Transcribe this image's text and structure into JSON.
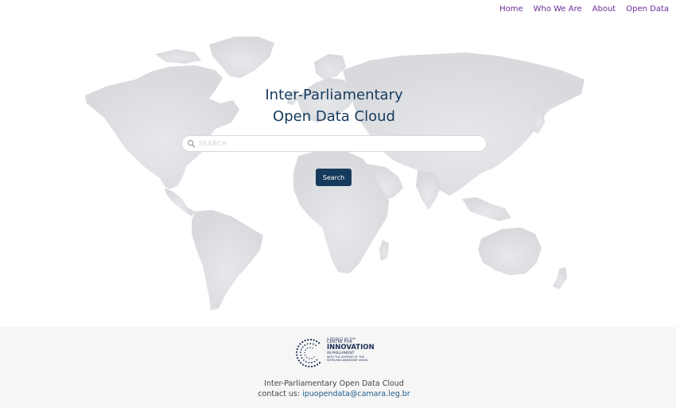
{
  "nav": {
    "items": [
      {
        "label": "Home"
      },
      {
        "label": "Who We Are"
      },
      {
        "label": "About"
      },
      {
        "label": "Open Data"
      }
    ]
  },
  "hero": {
    "title_line1": "Inter-Parliamentary",
    "title_line2": "Open Data Cloud"
  },
  "search": {
    "placeholder": "SEARCH",
    "value": "",
    "button_label": "Search"
  },
  "footer": {
    "logo": {
      "line1": "A PROJECT BY THE",
      "line2": "CENTRE FOR",
      "line3": "INNOVATION",
      "line4": "IN PARLIAMENT",
      "line5": "WITH THE SUPPORT OF THE INTER-PARLIAMENTARY UNION"
    },
    "site_name": "Inter-Parliamentary Open Data Cloud",
    "contact_label": "contact us:",
    "contact_email": "ipuopendata@camara.leg.br"
  },
  "colors": {
    "brand": "#163a5c",
    "nav_link": "#6a2a96",
    "map": "#dcdee1",
    "footer_bg": "#f6f6f6"
  }
}
